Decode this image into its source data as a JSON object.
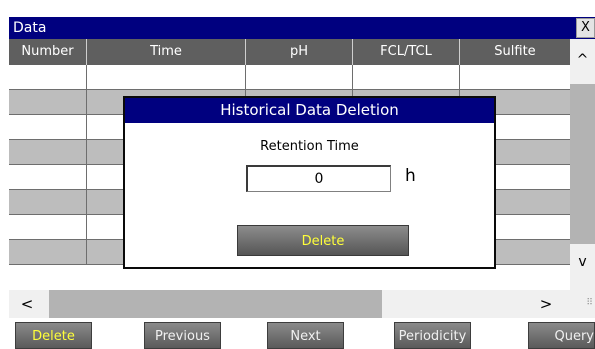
{
  "window": {
    "title": "Data",
    "close_label": "X"
  },
  "table": {
    "columns": [
      "Number",
      "Time",
      "pH",
      "FCL/TCL",
      "Sulfite"
    ],
    "row_count": 8
  },
  "scroll": {
    "up_icon": "chevron-up-icon",
    "down_icon": "chevron-down-icon",
    "left_icon": "chevron-left-icon",
    "right_icon": "chevron-right-icon",
    "up_glyph": "^",
    "down_glyph": "v",
    "left_glyph": "<",
    "right_glyph": ">"
  },
  "toolbar": {
    "delete": "Delete",
    "previous": "Previous",
    "next": "Next",
    "periodicity": "Periodicity",
    "query": "Query"
  },
  "dialog": {
    "title": "Historical Data Deletion",
    "label": "Retention Time",
    "value": "0",
    "unit": "h",
    "button": "Delete"
  },
  "colors": {
    "titlebar": "#00007f",
    "active_text": "#ffff3a",
    "header": "#5f5f5f"
  }
}
